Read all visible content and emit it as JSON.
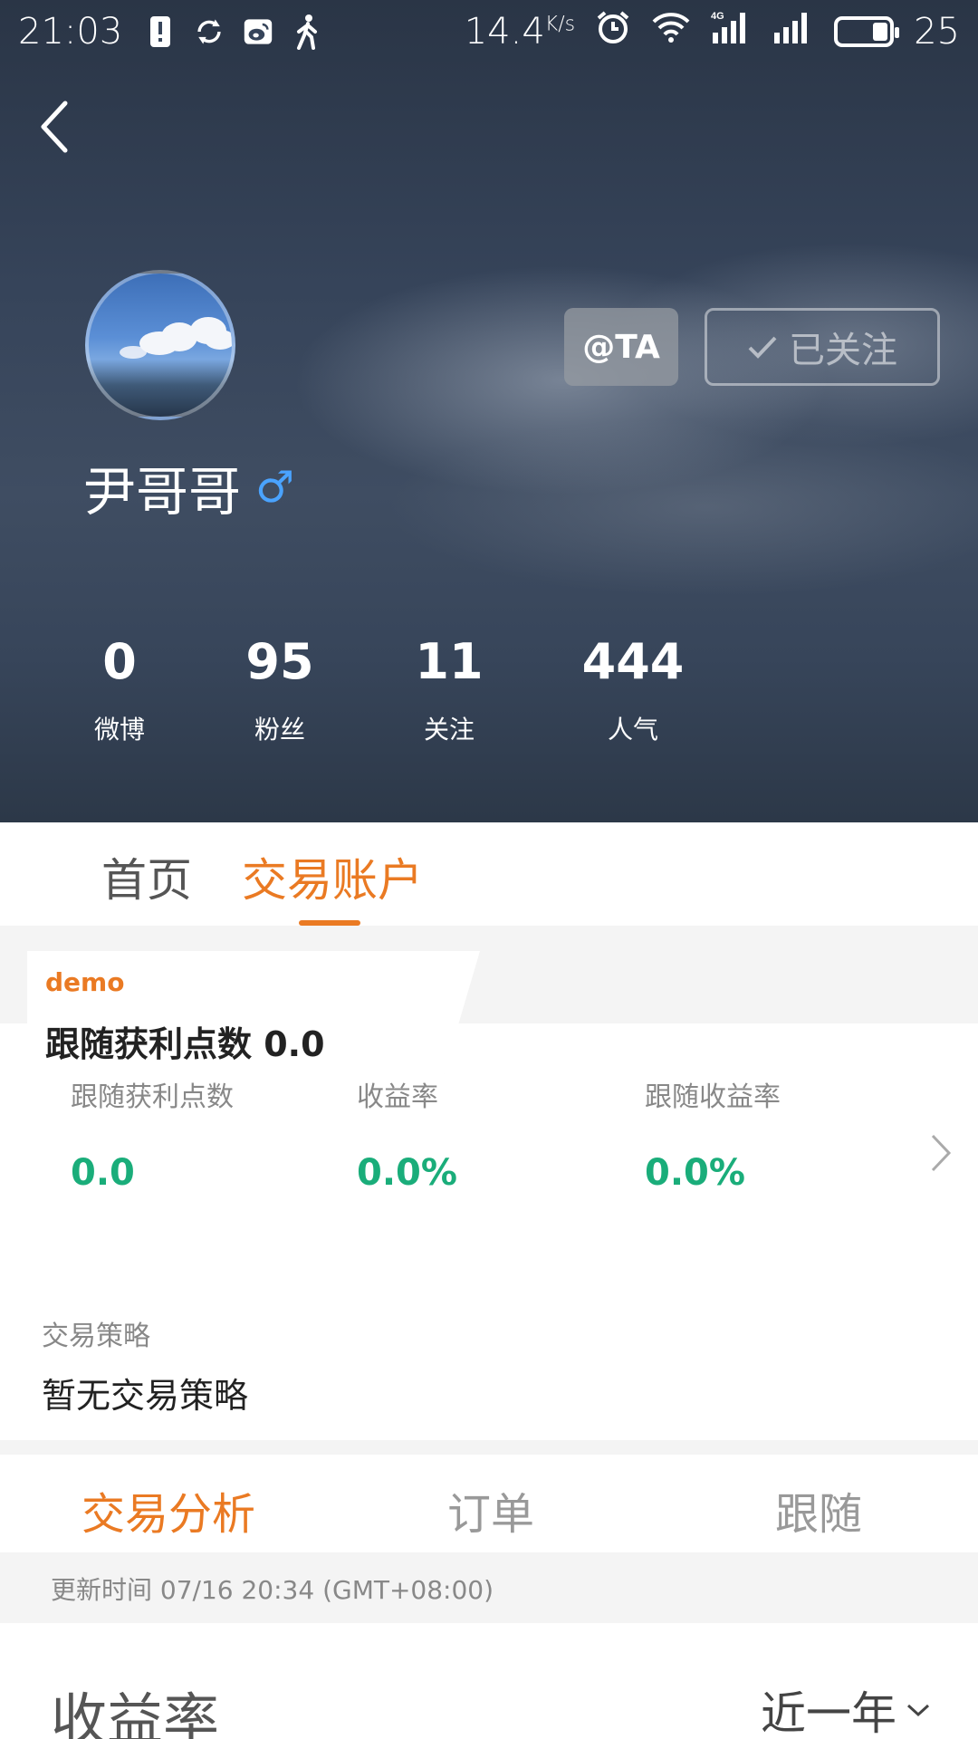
{
  "status_bar": {
    "time": "21:03",
    "left_icons": [
      "alert-icon",
      "sync-icon",
      "weibo-icon",
      "walking-icon"
    ],
    "network_speed": "14.4",
    "network_unit": "K/s",
    "battery_level": "25"
  },
  "profile": {
    "username": "尹哥哥",
    "gender_symbol": "♂",
    "at_button": "@TA",
    "follow_button": "已关注",
    "stats": [
      {
        "value": "0",
        "label": "微博"
      },
      {
        "value": "95",
        "label": "粉丝"
      },
      {
        "value": "11",
        "label": "关注"
      },
      {
        "value": "444",
        "label": "人气"
      }
    ]
  },
  "main_tabs": [
    {
      "label": "首页",
      "active": false
    },
    {
      "label": "交易账户",
      "active": true
    }
  ],
  "account": {
    "name": "demo",
    "points_summary": "跟随获利点数 0.0",
    "metrics": [
      {
        "label": "跟随获利点数",
        "value": "0.0"
      },
      {
        "label": "收益率",
        "value": "0.0%"
      },
      {
        "label": "跟随收益率",
        "value": "0.0%"
      }
    ],
    "strategy_label": "交易策略",
    "strategy_value": "暂无交易策略"
  },
  "sub_tabs": [
    {
      "label": "交易分析",
      "active": true
    },
    {
      "label": "订单",
      "active": false
    },
    {
      "label": "跟随",
      "active": false
    }
  ],
  "update_time": "更新时间 07/16 20:34 (GMT+08:00)",
  "yield_section": {
    "title": "收益率",
    "period": "近一年"
  },
  "colors": {
    "accent": "#ea7a23",
    "positive": "#1aad7a",
    "gender": "#4aa3ff"
  }
}
